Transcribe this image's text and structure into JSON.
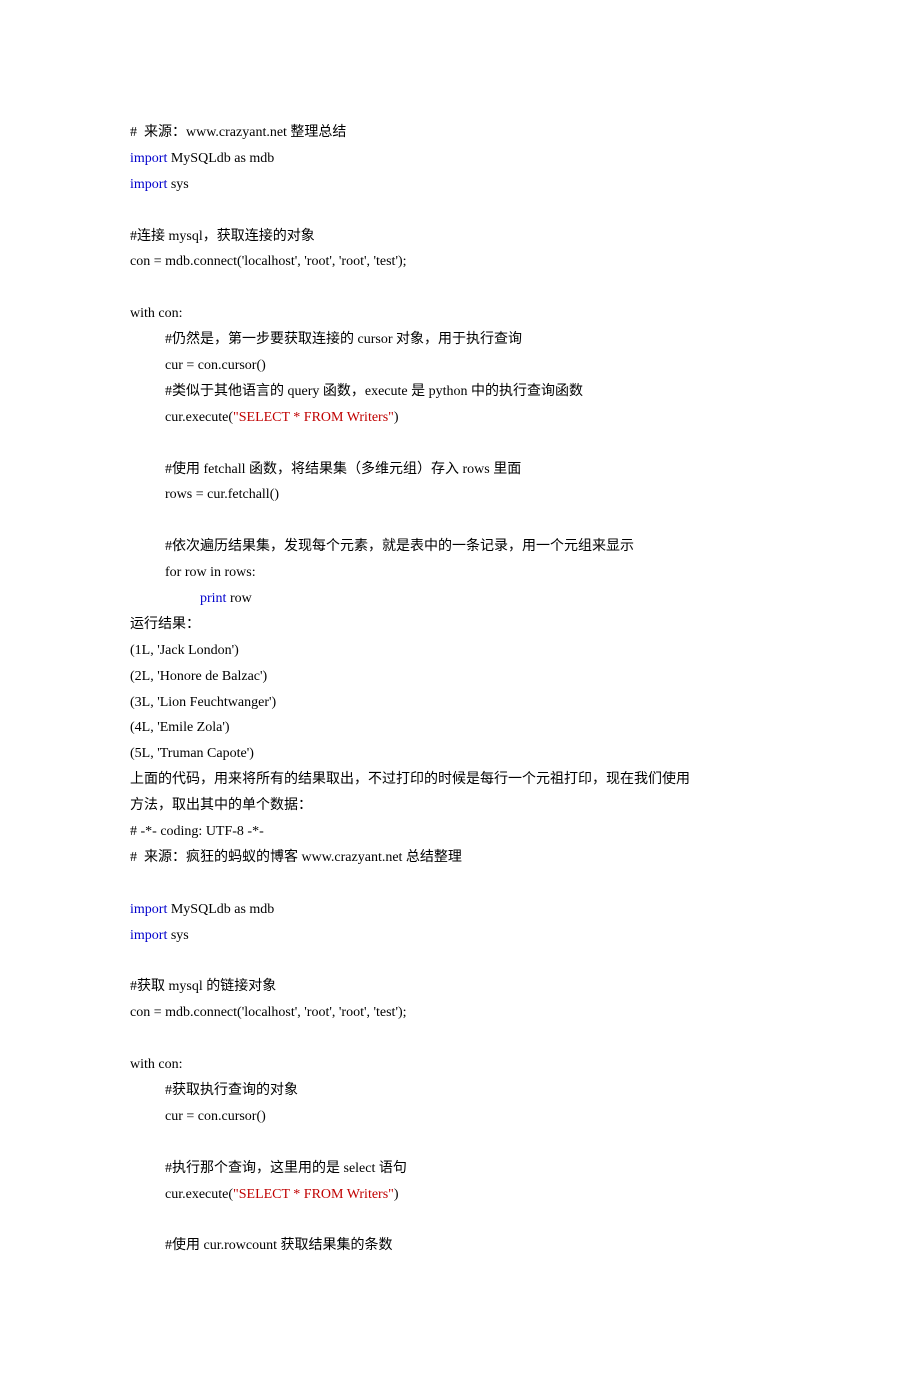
{
  "lines": [
    {
      "cls": "",
      "segs": [
        {
          "t": "#  来源：www.crazyant.net 整理总结"
        }
      ]
    },
    {
      "cls": "",
      "segs": [
        {
          "t": "import",
          "k": true
        },
        {
          "t": " MySQLdb as mdb"
        }
      ]
    },
    {
      "cls": "",
      "segs": [
        {
          "t": "import",
          "k": true
        },
        {
          "t": " sys"
        }
      ]
    },
    {
      "cls": "",
      "segs": [
        {
          "t": " "
        }
      ]
    },
    {
      "cls": "",
      "segs": [
        {
          "t": "#连接 mysql，获取连接的对象"
        }
      ]
    },
    {
      "cls": "",
      "segs": [
        {
          "t": "con = mdb.connect('localhost', 'root', 'root', 'test');"
        }
      ]
    },
    {
      "cls": "",
      "segs": [
        {
          "t": " "
        }
      ]
    },
    {
      "cls": "",
      "segs": [
        {
          "t": "with con:"
        }
      ]
    },
    {
      "cls": "indent1",
      "segs": [
        {
          "t": "#仍然是，第一步要获取连接的 cursor 对象，用于执行查询"
        }
      ]
    },
    {
      "cls": "indent1",
      "segs": [
        {
          "t": "cur = con.cursor()"
        }
      ]
    },
    {
      "cls": "indent1",
      "segs": [
        {
          "t": "#类似于其他语言的 query 函数，execute 是 python 中的执行查询函数"
        }
      ]
    },
    {
      "cls": "indent1",
      "segs": [
        {
          "t": "cur.execute("
        },
        {
          "t": "\"SELECT * FROM Writers\"",
          "s": true
        },
        {
          "t": ")"
        }
      ]
    },
    {
      "cls": "",
      "segs": [
        {
          "t": " "
        }
      ]
    },
    {
      "cls": "indent1",
      "segs": [
        {
          "t": "#使用 fetchall 函数，将结果集（多维元组）存入 rows 里面"
        }
      ]
    },
    {
      "cls": "indent1",
      "segs": [
        {
          "t": "rows = cur.fetchall()"
        }
      ]
    },
    {
      "cls": "",
      "segs": [
        {
          "t": " "
        }
      ]
    },
    {
      "cls": "indent1",
      "segs": [
        {
          "t": "#依次遍历结果集，发现每个元素，就是表中的一条记录，用一个元组来显示"
        }
      ]
    },
    {
      "cls": "indent1",
      "segs": [
        {
          "t": "for row in rows:"
        }
      ]
    },
    {
      "cls": "indent2",
      "segs": [
        {
          "t": "print",
          "k": true
        },
        {
          "t": " row"
        }
      ]
    },
    {
      "cls": "",
      "segs": [
        {
          "t": "运行结果："
        }
      ]
    },
    {
      "cls": "",
      "segs": [
        {
          "t": "(1L, 'Jack London')"
        }
      ]
    },
    {
      "cls": "",
      "segs": [
        {
          "t": "(2L, 'Honore de Balzac')"
        }
      ]
    },
    {
      "cls": "",
      "segs": [
        {
          "t": "(3L, 'Lion Feuchtwanger')"
        }
      ]
    },
    {
      "cls": "",
      "segs": [
        {
          "t": "(4L, 'Emile Zola')"
        }
      ]
    },
    {
      "cls": "",
      "segs": [
        {
          "t": "(5L, 'Truman Capote')"
        }
      ]
    },
    {
      "cls": "",
      "segs": [
        {
          "t": "上面的代码，用来将所有的结果取出，不过打印的时候是每行一个元祖打印，现在我们使用"
        }
      ]
    },
    {
      "cls": "",
      "segs": [
        {
          "t": "方法，取出其中的单个数据："
        }
      ]
    },
    {
      "cls": "",
      "segs": [
        {
          "t": "# -*- coding: UTF-8 -*-"
        }
      ]
    },
    {
      "cls": "",
      "segs": [
        {
          "t": "#  来源：疯狂的蚂蚁的博客 www.crazyant.net 总结整理"
        }
      ]
    },
    {
      "cls": "",
      "segs": [
        {
          "t": " "
        }
      ]
    },
    {
      "cls": "",
      "segs": [
        {
          "t": "import",
          "k": true
        },
        {
          "t": " MySQLdb as mdb"
        }
      ]
    },
    {
      "cls": "",
      "segs": [
        {
          "t": "import",
          "k": true
        },
        {
          "t": " sys"
        }
      ]
    },
    {
      "cls": "",
      "segs": [
        {
          "t": " "
        }
      ]
    },
    {
      "cls": "",
      "segs": [
        {
          "t": "#获取 mysql 的链接对象"
        }
      ]
    },
    {
      "cls": "",
      "segs": [
        {
          "t": "con = mdb.connect('localhost', 'root', 'root', 'test');"
        }
      ]
    },
    {
      "cls": "",
      "segs": [
        {
          "t": " "
        }
      ]
    },
    {
      "cls": "",
      "segs": [
        {
          "t": "with con:"
        }
      ]
    },
    {
      "cls": "indent1",
      "segs": [
        {
          "t": "#获取执行查询的对象"
        }
      ]
    },
    {
      "cls": "indent1",
      "segs": [
        {
          "t": "cur = con.cursor()"
        }
      ]
    },
    {
      "cls": "",
      "segs": [
        {
          "t": " "
        }
      ]
    },
    {
      "cls": "indent1",
      "segs": [
        {
          "t": "#执行那个查询，这里用的是 select 语句"
        }
      ]
    },
    {
      "cls": "indent1",
      "segs": [
        {
          "t": "cur.execute("
        },
        {
          "t": "\"SELECT * FROM Writers\"",
          "s": true
        },
        {
          "t": ")"
        }
      ]
    },
    {
      "cls": "",
      "segs": [
        {
          "t": " "
        }
      ]
    },
    {
      "cls": "indent1",
      "segs": [
        {
          "t": "#使用 cur.rowcount 获取结果集的条数"
        }
      ]
    }
  ]
}
